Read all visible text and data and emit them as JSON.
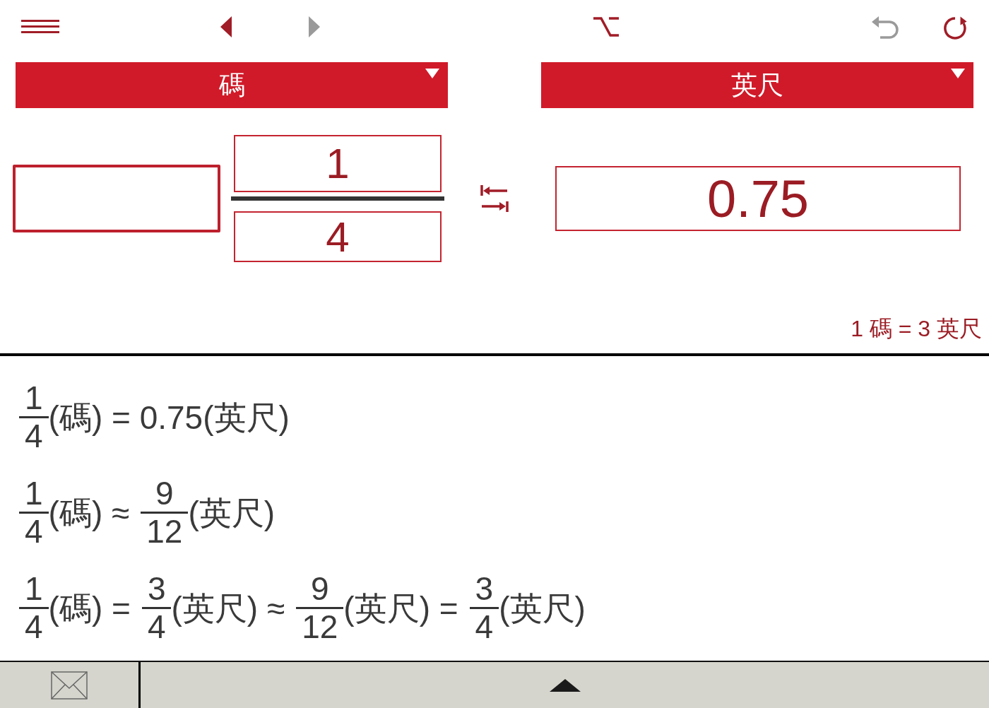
{
  "toolbar": [
    {
      "kind": "menu",
      "disabled": false
    },
    {
      "kind": "prev",
      "disabled": false
    },
    {
      "kind": "next",
      "disabled": true
    },
    {
      "kind": "option",
      "disabled": false
    },
    {
      "kind": "undo",
      "disabled": true
    },
    {
      "kind": "reload",
      "disabled": false
    }
  ],
  "unit_selectors": [
    {
      "label": "碼"
    },
    {
      "label": "英尺"
    }
  ],
  "converter": {
    "whole": {
      "focused": true
    },
    "numerator": "1",
    "denominator": "4",
    "result": "0.75"
  },
  "definition": "1 碼 = 3 英尺",
  "results": [
    {
      "parts": [
        {
          "kind": "frac",
          "numerator": "1",
          "denominator": "4"
        },
        {
          "kind": "text",
          "text": "(碼) = 0.75(英尺)"
        }
      ]
    },
    {
      "parts": [
        {
          "kind": "frac",
          "numerator": "1",
          "denominator": "4"
        },
        {
          "kind": "text",
          "text": "(碼) ≈"
        },
        {
          "kind": "frac",
          "numerator": "9",
          "denominator": "12"
        },
        {
          "kind": "text",
          "text": "(英尺)"
        }
      ]
    },
    {
      "parts": [
        {
          "kind": "frac",
          "numerator": "1",
          "denominator": "4"
        },
        {
          "kind": "text",
          "text": "(碼) ="
        },
        {
          "kind": "frac",
          "numerator": "3",
          "denominator": "4"
        },
        {
          "kind": "text",
          "text": "(英尺) ≈"
        },
        {
          "kind": "frac",
          "numerator": "9",
          "denominator": "12"
        },
        {
          "kind": "text",
          "text": "(英尺) ="
        },
        {
          "kind": "frac",
          "numerator": "3",
          "denominator": "4"
        },
        {
          "kind": "text",
          "text": "(英尺)"
        }
      ]
    }
  ],
  "bottom_bar": [
    {
      "kind": "mail"
    },
    {
      "kind": "expand"
    }
  ]
}
